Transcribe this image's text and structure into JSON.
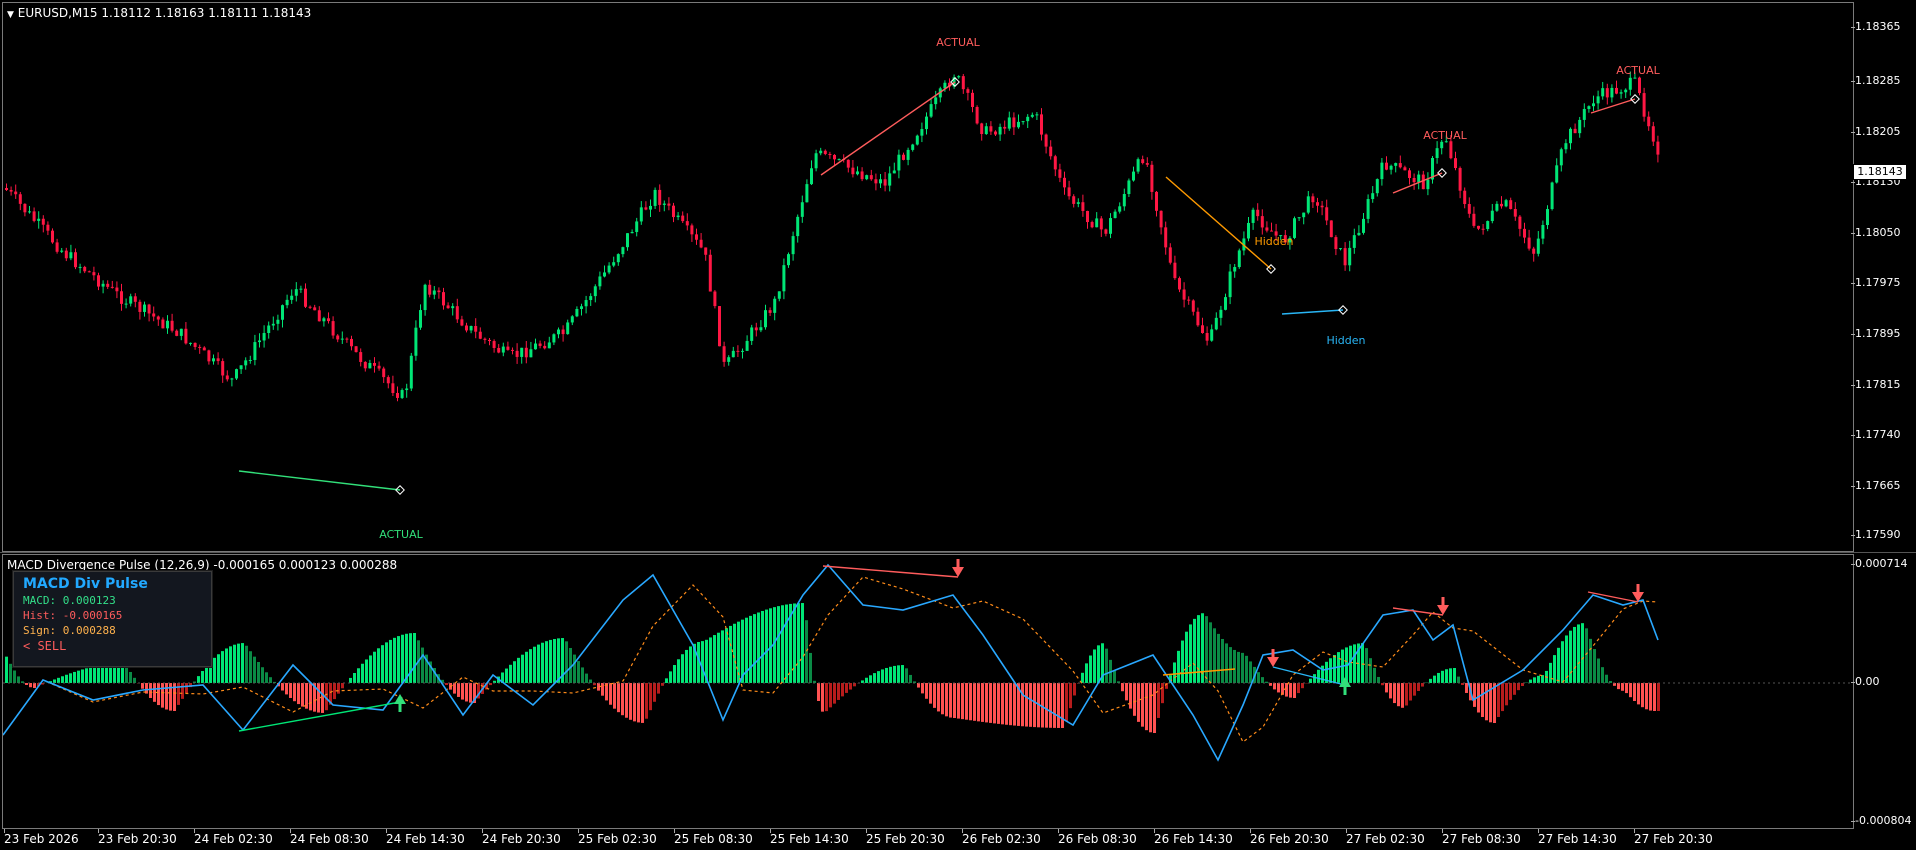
{
  "main_chart": {
    "header": "EURUSD,M15  1.18112 1.18163 1.18111 1.18143",
    "current_price_tag": "1.18143",
    "price_axis": [
      "1.18365",
      "1.18285",
      "1.18205",
      "1.18130",
      "1.18050",
      "1.17975",
      "1.17895",
      "1.17815",
      "1.17740",
      "1.17665",
      "1.17590"
    ],
    "divergence_labels": [
      "ACTUAL",
      "ACTUAL",
      "ACTUAL",
      "ACTUAL",
      "Hidden",
      "Hidden"
    ],
    "colors": {
      "bull": "#00e676",
      "bear": "#ff1744",
      "bear_div": "#ff5c5c",
      "bull_div": "#32e07a",
      "hidden_bear": "#ff9a00",
      "hidden_bull": "#29b6f6"
    }
  },
  "indicator": {
    "header": "MACD Divergence Pulse (12,26,9) -0.000165 0.000123 0.000288",
    "axis": [
      "0.000714",
      "0.00",
      "-0.000804"
    ],
    "panel": {
      "title": "MACD Div Pulse",
      "macd": "MACD: 0.000123",
      "hist": "Hist: -0.000165",
      "sign": "Sign: 0.000288",
      "signal": "< SELL"
    },
    "colors": {
      "macd": "#29a8ff",
      "signal": "#ff8c1a",
      "hist_pos": "#00e676",
      "hist_pos_weak": "#0a8a45",
      "hist_neg": "#ff5252",
      "hist_neg_weak": "#b71c1c"
    }
  },
  "time_axis": [
    "23 Feb 2026",
    "23 Feb 20:30",
    "24 Feb 02:30",
    "24 Feb 08:30",
    "24 Feb 14:30",
    "24 Feb 20:30",
    "25 Feb 02:30",
    "25 Feb 08:30",
    "25 Feb 14:30",
    "25 Feb 20:30",
    "26 Feb 02:30",
    "26 Feb 08:30",
    "26 Feb 14:30",
    "26 Feb 20:30",
    "27 Feb 02:30",
    "27 Feb 08:30",
    "27 Feb 14:30",
    "27 Feb 20:30"
  ]
}
